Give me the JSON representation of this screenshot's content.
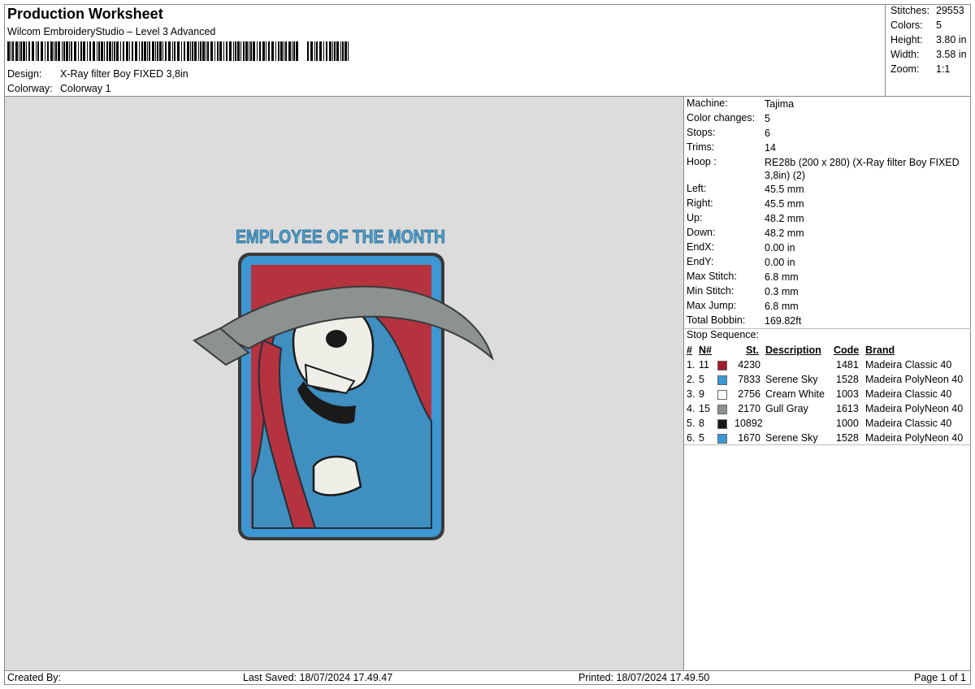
{
  "header": {
    "title": "Production Worksheet",
    "subtitle": "Wilcom EmbroideryStudio – Level 3 Advanced",
    "design_label": "Design:",
    "design_value": "X-Ray filter Boy FIXED 3,8in",
    "colorway_label": "Colorway:",
    "colorway_value": "Colorway 1"
  },
  "stats": [
    {
      "label": "Stitches:",
      "value": "29553"
    },
    {
      "label": "Colors:",
      "value": "5"
    },
    {
      "label": "Height:",
      "value": "3.80 in"
    },
    {
      "label": "Width:",
      "value": "3.58 in"
    },
    {
      "label": "Zoom:",
      "value": "1:1"
    }
  ],
  "design_preview": {
    "text": "EMPLOYEE OF THE MONTH"
  },
  "properties": [
    {
      "label": "Machine:",
      "value": "Tajima"
    },
    {
      "label": "Color changes:",
      "value": "5"
    },
    {
      "label": "Stops:",
      "value": "6"
    },
    {
      "label": "Trims:",
      "value": "14"
    },
    {
      "label": "Hoop :",
      "value": "RE28b (200 x 280) (X-Ray filter Boy FIXED 3,8in) (2)"
    },
    {
      "label": "Left:",
      "value": "45.5 mm"
    },
    {
      "label": "Right:",
      "value": "45.5 mm"
    },
    {
      "label": "Up:",
      "value": "48.2 mm"
    },
    {
      "label": "Down:",
      "value": "48.2 mm"
    },
    {
      "label": "EndX:",
      "value": "0.00 in"
    },
    {
      "label": "EndY:",
      "value": "0.00 in"
    },
    {
      "label": "Max Stitch:",
      "value": "6.8 mm"
    },
    {
      "label": "Min Stitch:",
      "value": "0.3 mm"
    },
    {
      "label": "Max Jump:",
      "value": "6.8 mm"
    },
    {
      "label": "Total Bobbin:",
      "value": "169.82ft"
    }
  ],
  "stop_sequence": {
    "label": "Stop Sequence:",
    "headers": {
      "num": "#",
      "n": "N#",
      "st": "St.",
      "description": "Description",
      "code": "Code",
      "brand": "Brand"
    },
    "rows": [
      {
        "num": "1.",
        "n": "11",
        "color": "#a51b2a",
        "st": "4230",
        "description": "",
        "code": "1481",
        "brand": "Madeira Classic 40"
      },
      {
        "num": "2.",
        "n": "5",
        "color": "#3c97d3",
        "st": "7833",
        "description": "Serene Sky",
        "code": "1528",
        "brand": "Madeira PolyNeon 40"
      },
      {
        "num": "3.",
        "n": "9",
        "color": "#ffffff",
        "st": "2756",
        "description": "Cream White",
        "code": "1003",
        "brand": "Madeira Classic 40"
      },
      {
        "num": "4.",
        "n": "15",
        "color": "#8c9290",
        "st": "2170",
        "description": "Gull Gray",
        "code": "1613",
        "brand": "Madeira PolyNeon 40"
      },
      {
        "num": "5.",
        "n": "8",
        "color": "#1a1a1a",
        "st": "10892",
        "description": "",
        "code": "1000",
        "brand": "Madeira Classic 40"
      },
      {
        "num": "6.",
        "n": "5",
        "color": "#3c97d3",
        "st": "1670",
        "description": "Serene Sky",
        "code": "1528",
        "brand": "Madeira PolyNeon 40"
      }
    ]
  },
  "footer": {
    "created_by": "Created By:",
    "last_saved": "Last Saved: 18/07/2024 17.49.47",
    "printed": "Printed: 18/07/2024 17.49.50",
    "page": "Page 1 of 1"
  }
}
